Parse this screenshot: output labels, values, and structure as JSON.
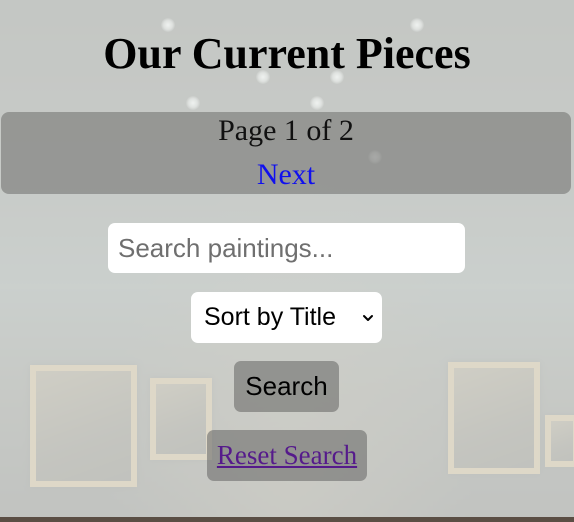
{
  "page": {
    "title": "Our Current Pieces"
  },
  "pagination": {
    "indicator": "Page 1 of 2",
    "next_label": "Next"
  },
  "search": {
    "placeholder": "Search paintings...",
    "value": ""
  },
  "sort": {
    "selected": "Sort by Title"
  },
  "actions": {
    "search_label": "Search",
    "reset_label": "Reset Search"
  },
  "colors": {
    "link": "#1010ee",
    "visited_link": "#551a8b",
    "panel": "#6e6e6c"
  },
  "icons": {
    "sort": "chevron-down-icon"
  }
}
